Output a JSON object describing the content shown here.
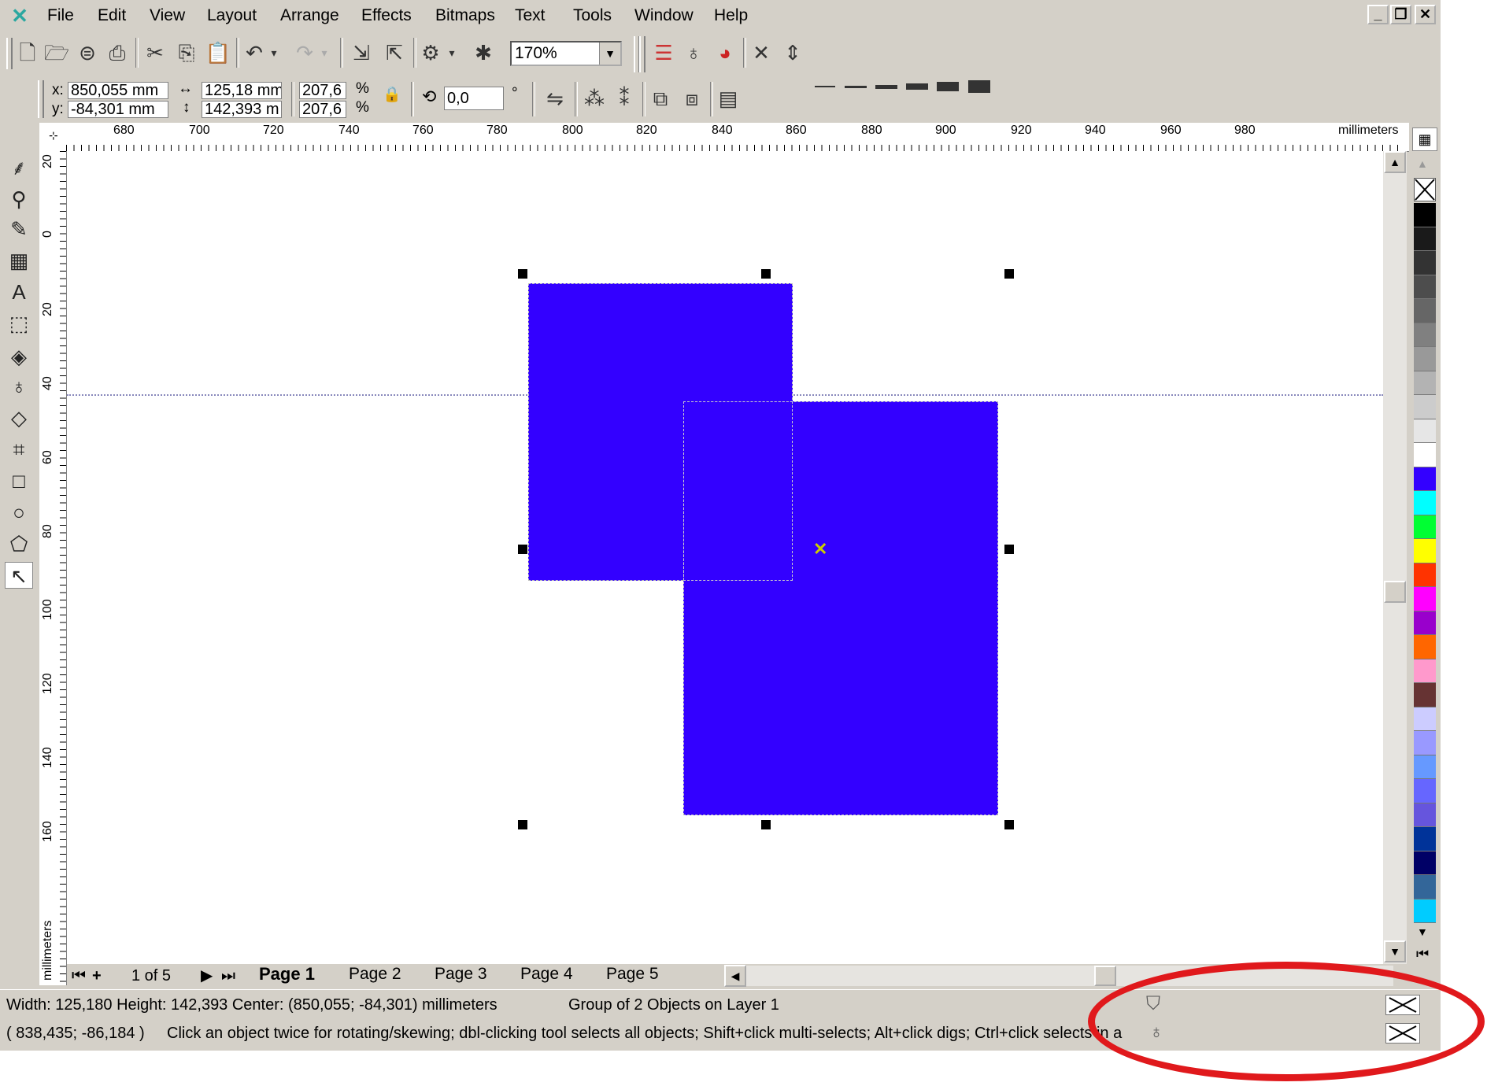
{
  "menu": {
    "items": [
      "File",
      "Edit",
      "View",
      "Layout",
      "Arrange",
      "Effects",
      "Bitmaps",
      "Text",
      "Tools",
      "Window",
      "Help"
    ]
  },
  "window_controls": {
    "minimize": "_",
    "restore": "❐",
    "close": "✕"
  },
  "toolbar": {
    "zoom_value": "170%"
  },
  "property_bar": {
    "x_label": "x:",
    "x_value": "850,055 mm",
    "y_label": "y:",
    "y_value": "-84,301 mm",
    "width_value": "125,18 mm",
    "height_value": "142,393 m",
    "scale_x": "207,6",
    "scale_y": "207,6",
    "pct_x": "%",
    "pct_y": "%",
    "rotation_value": "0,0",
    "degree": "°"
  },
  "ruler": {
    "unit": "millimeters",
    "h_ticks": [
      "680",
      "700",
      "720",
      "740",
      "760",
      "780",
      "800",
      "820",
      "840",
      "860",
      "880",
      "900",
      "920",
      "940",
      "960",
      "980"
    ],
    "v_ticks": [
      "20",
      "0",
      "20",
      "40",
      "60",
      "80",
      "100",
      "120",
      "140",
      "160"
    ],
    "v_unit": "millimeters"
  },
  "palette": {
    "colors": [
      "#000000",
      "#1a1a1a",
      "#333333",
      "#4d4d4d",
      "#666666",
      "#808080",
      "#999999",
      "#b3b3b3",
      "#cccccc",
      "#e6e6e6",
      "#ffffff",
      "#3300ff",
      "#00ffff",
      "#00ff33",
      "#ffff00",
      "#ff3300",
      "#ff00ff",
      "#9900cc",
      "#ff6600",
      "#ff99cc",
      "#663333",
      "#ccccff",
      "#9999ff",
      "#6699ff",
      "#6666ff",
      "#6655dd",
      "#003399",
      "#000066",
      "#336699",
      "#00ccff"
    ]
  },
  "pages": {
    "counter": "1 of 5",
    "tabs": [
      "Page 1",
      "Page 2",
      "Page 3",
      "Page 4",
      "Page 5"
    ]
  },
  "status": {
    "line1": "Width: 125,180  Height: 142,393  Center: (850,055; -84,301)  millimeters",
    "selection": "Group of 2 Objects on Layer 1",
    "coords": "( 838,435; -86,184 )",
    "hint": "Click an object twice for rotating/skewing; dbl-clicking tool selects all objects; Shift+click multi-selects; Alt+click digs; Ctrl+click selects in a group"
  }
}
